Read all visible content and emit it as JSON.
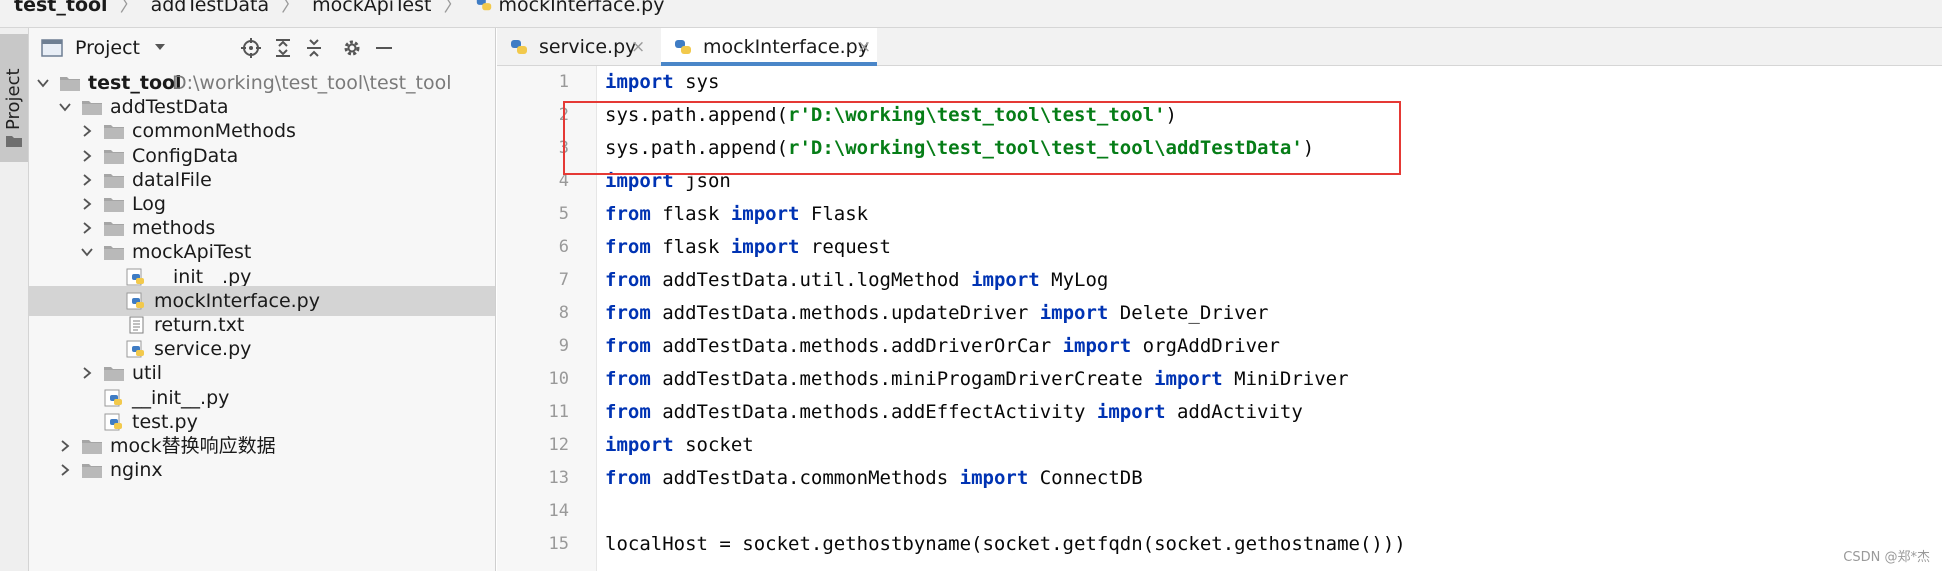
{
  "breadcrumb": [
    "test_tool",
    "addTestData",
    "mockApiTest",
    "mockInterface.py"
  ],
  "tool_strip": {
    "project_tab": "Project"
  },
  "project_panel": {
    "title": "Project",
    "toolbar": [
      "locate-icon",
      "expand-all-icon",
      "collapse-all-icon",
      "gear-icon",
      "minimize-icon"
    ],
    "tree": [
      {
        "label": "test_tool",
        "path": "D:\\working\\test_tool\\test_tool",
        "type": "folder",
        "expanded": true,
        "depth": 0,
        "bold": true
      },
      {
        "label": "addTestData",
        "type": "folder",
        "expanded": true,
        "depth": 1
      },
      {
        "label": "commonMethods",
        "type": "folder",
        "expanded": false,
        "depth": 2
      },
      {
        "label": "ConfigData",
        "type": "folder",
        "expanded": false,
        "depth": 2
      },
      {
        "label": "datalFile",
        "type": "folder",
        "expanded": false,
        "depth": 2
      },
      {
        "label": "Log",
        "type": "folder",
        "expanded": false,
        "depth": 2
      },
      {
        "label": "methods",
        "type": "folder",
        "expanded": false,
        "depth": 2
      },
      {
        "label": "mockApiTest",
        "type": "folder",
        "expanded": true,
        "depth": 2
      },
      {
        "label": "__init__.py",
        "type": "python",
        "depth": 3
      },
      {
        "label": "mockInterface.py",
        "type": "python",
        "depth": 3,
        "selected": true
      },
      {
        "label": "return.txt",
        "type": "text",
        "depth": 3
      },
      {
        "label": "service.py",
        "type": "python",
        "depth": 3
      },
      {
        "label": "util",
        "type": "folder",
        "expanded": false,
        "depth": 2
      },
      {
        "label": "__init__.py",
        "type": "python",
        "depth": 2
      },
      {
        "label": "test.py",
        "type": "python",
        "depth": 2
      },
      {
        "label": "mock替换响应数据",
        "type": "folder",
        "expanded": false,
        "depth": 1
      },
      {
        "label": "nginx",
        "type": "folder",
        "expanded": false,
        "depth": 1
      }
    ]
  },
  "editor": {
    "tabs": [
      {
        "name": "service.py",
        "active": false,
        "close": "×"
      },
      {
        "name": "mockInterface.py",
        "active": true,
        "close": "×"
      }
    ],
    "lines": [
      [
        [
          "kw",
          "import"
        ],
        [
          "t",
          " sys"
        ]
      ],
      [
        [
          "t",
          "sys.path.append("
        ],
        [
          "str",
          "r'D:\\working\\test_tool\\test_tool'"
        ],
        [
          "t",
          ")"
        ]
      ],
      [
        [
          "t",
          "sys.path.append("
        ],
        [
          "str",
          "r'D:\\working\\test_tool\\test_tool\\addTestData'"
        ],
        [
          "t",
          ")"
        ]
      ],
      [
        [
          "kw",
          "import"
        ],
        [
          "t",
          " json"
        ]
      ],
      [
        [
          "kw",
          "from"
        ],
        [
          "t",
          " flask "
        ],
        [
          "kw",
          "import"
        ],
        [
          "t",
          " Flask"
        ]
      ],
      [
        [
          "kw",
          "from"
        ],
        [
          "t",
          " flask "
        ],
        [
          "kw",
          "import"
        ],
        [
          "t",
          " request"
        ]
      ],
      [
        [
          "kw",
          "from"
        ],
        [
          "t",
          " addTestData.util.logMethod "
        ],
        [
          "kw",
          "import"
        ],
        [
          "t",
          " MyLog"
        ]
      ],
      [
        [
          "kw",
          "from"
        ],
        [
          "t",
          " addTestData.methods.updateDriver "
        ],
        [
          "kw",
          "import"
        ],
        [
          "t",
          " Delete_Driver"
        ]
      ],
      [
        [
          "kw",
          "from"
        ],
        [
          "t",
          " addTestData.methods.addDriverOrCar "
        ],
        [
          "kw",
          "import"
        ],
        [
          "t",
          " orgAddDriver"
        ]
      ],
      [
        [
          "kw",
          "from"
        ],
        [
          "t",
          " addTestData.methods.miniProgamDriverCreate "
        ],
        [
          "kw",
          "import"
        ],
        [
          "t",
          " MiniDriver"
        ]
      ],
      [
        [
          "kw",
          "from"
        ],
        [
          "t",
          " addTestData.methods.addEffectActivity "
        ],
        [
          "kw",
          "import"
        ],
        [
          "t",
          " addActivity"
        ]
      ],
      [
        [
          "kw",
          "import"
        ],
        [
          "t",
          " socket"
        ]
      ],
      [
        [
          "kw",
          "from"
        ],
        [
          "t",
          " addTestData.commonMethods "
        ],
        [
          "kw",
          "import"
        ],
        [
          "t",
          " ConnectDB"
        ]
      ],
      [],
      [
        [
          "t",
          "localHost = socket.gethostbyname(socket.getfqdn(socket.gethostname()))"
        ]
      ]
    ]
  },
  "watermark": "CSDN @郑*杰",
  "colors": {
    "keyword": "#0033b3",
    "string": "#067d17",
    "highlight": "#e53935",
    "selection": "#d4d4d4",
    "tab_accent": "#4a86c8"
  }
}
